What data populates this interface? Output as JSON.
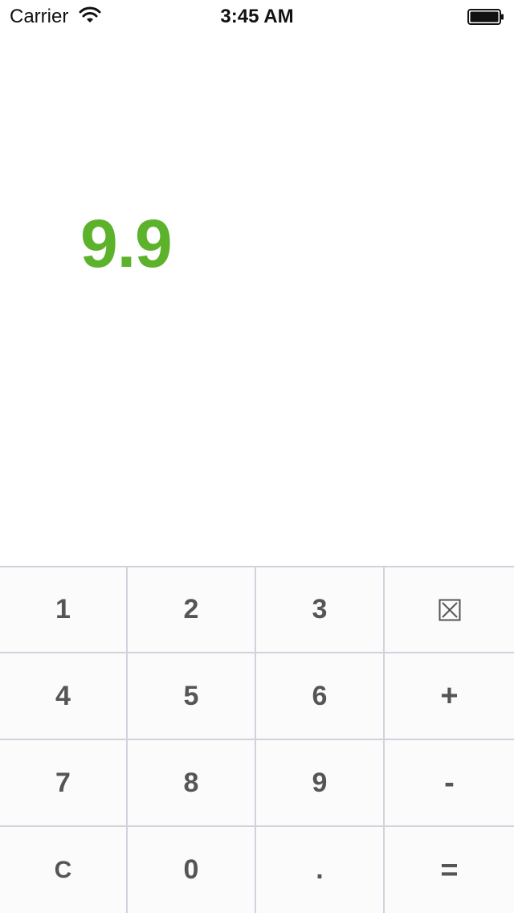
{
  "status_bar": {
    "carrier": "Carrier",
    "time": "3:45 AM",
    "wifi_icon": "wifi-icon",
    "battery_icon": "battery-icon"
  },
  "display": {
    "value": "9.9",
    "color": "#5db22b"
  },
  "keypad": {
    "rows": [
      [
        "1",
        "2",
        "3",
        "⊠"
      ],
      [
        "4",
        "5",
        "6",
        "+"
      ],
      [
        "7",
        "8",
        "9",
        "-"
      ],
      [
        "C",
        "0",
        ".",
        "="
      ]
    ],
    "delete_icon": "delete-icon",
    "key_text_color": "#555555",
    "divider_color": "#d2d2dc"
  }
}
